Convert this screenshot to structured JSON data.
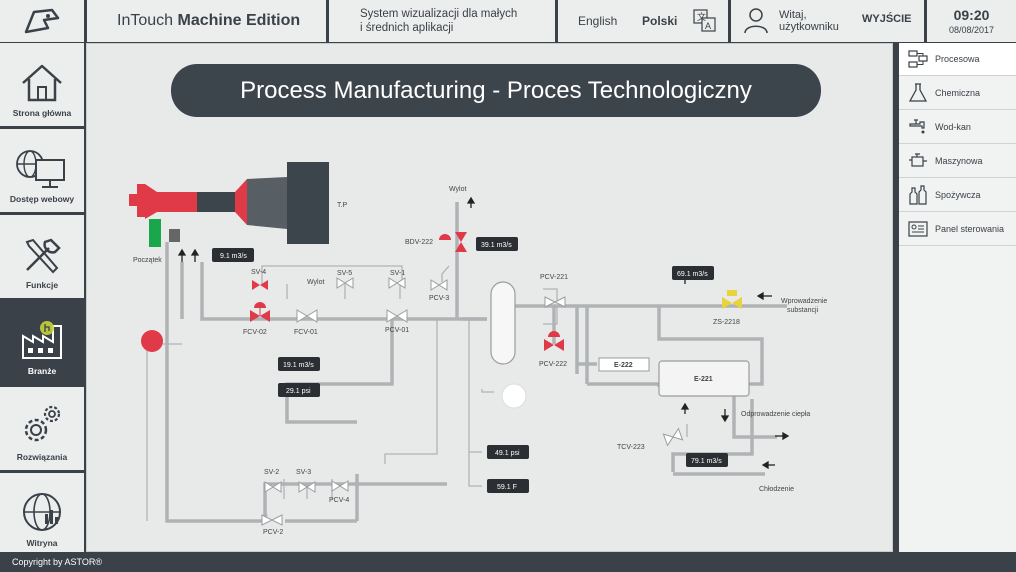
{
  "header": {
    "title_regular": "InTouch ",
    "title_bold": "Machine Edition",
    "subtitle_line1": "System wizualizacji dla małych",
    "subtitle_line2": "i średnich aplikacji",
    "lang_en": "English",
    "lang_pl": "Polski",
    "greet_line1": "Witaj,",
    "greet_line2": "użytkowniku",
    "logout": "WYJŚCIE",
    "time": "09:20",
    "date": "08/08/2017"
  },
  "left_nav": [
    {
      "label": "Strona główna",
      "icon": "home-icon"
    },
    {
      "label": "Dostęp webowy",
      "icon": "web-access-icon"
    },
    {
      "label": "Funkcje",
      "icon": "tools-icon"
    },
    {
      "label": "Branże",
      "icon": "factory-icon",
      "active": true
    },
    {
      "label": "Rozwiązania",
      "icon": "gears-icon"
    },
    {
      "label": "Witryna",
      "icon": "globe-icon"
    }
  ],
  "right_nav": [
    {
      "label": "Procesowa",
      "icon": "process-icon",
      "active": true
    },
    {
      "label": "Chemiczna",
      "icon": "flask-icon"
    },
    {
      "label": "Wod-kan",
      "icon": "faucet-icon"
    },
    {
      "label": "Maszynowa",
      "icon": "engine-icon"
    },
    {
      "label": "Spożywcza",
      "icon": "bottles-icon"
    },
    {
      "label": "Panel sterowania",
      "icon": "control-panel-icon"
    }
  ],
  "banner": "Process Manufacturing - Proces Technologiczny",
  "diagram": {
    "labels": {
      "tp": "T.P",
      "start": "Początek",
      "outlet_top": "Wylot",
      "outlet_mid": "Wylot",
      "bdv222": "BDV-222",
      "sv4": "SV-4",
      "sv5": "SV-5",
      "sv1": "SV-1",
      "fcv02": "FCV-02",
      "fcv01": "FCV-01",
      "pcv01": "PCV-01",
      "pcv3": "PCV-3",
      "pcv221": "PCV-221",
      "pcv222": "PCV-222",
      "e222": "E-222",
      "e221": "E-221",
      "zs2218": "ZS-2218",
      "input_l1": "Wprowadzenie",
      "input_l2": "substancji",
      "heat_out": "Odprowadzenie ciepła",
      "tcv223": "TCV-223",
      "cooling": "Chłodzenie",
      "sv2": "SV-2",
      "sv3": "SV-3",
      "pcv4": "PCV-4",
      "pcv2": "PCV-2"
    },
    "values": {
      "v1": "9.1 m3/s",
      "v2": "39.1 m3/s",
      "v3": "69.1 m3/s",
      "v4": "19.1 m3/s",
      "v5": "29.1 psi",
      "v6": "49.1 psi",
      "v7": "59.1 F",
      "v8": "79.1 m3/s"
    }
  },
  "footer": "Copyright by ASTOR®",
  "colors": {
    "dark": "#3a4148",
    "panel": "#eceded",
    "accent_red": "#e03a48",
    "green": "#1aa64a",
    "yellow": "#e8d33a"
  }
}
